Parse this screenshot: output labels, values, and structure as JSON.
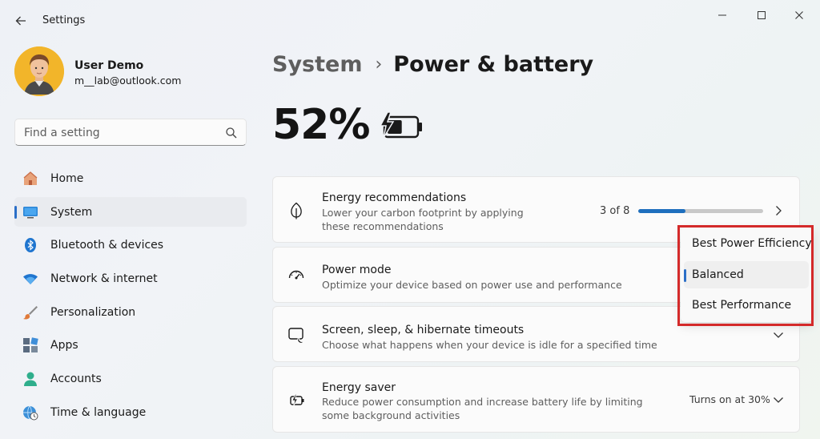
{
  "window": {
    "title": "Settings"
  },
  "user": {
    "name": "User Demo",
    "email": "m__lab@outlook.com"
  },
  "search": {
    "placeholder": "Find a setting"
  },
  "sidebar": {
    "items": [
      {
        "label": "Home",
        "icon": "home-icon",
        "selected": false
      },
      {
        "label": "System",
        "icon": "system-display-icon",
        "selected": true
      },
      {
        "label": "Bluetooth & devices",
        "icon": "bluetooth-icon",
        "selected": false
      },
      {
        "label": "Network & internet",
        "icon": "wifi-icon",
        "selected": false
      },
      {
        "label": "Personalization",
        "icon": "brush-icon",
        "selected": false
      },
      {
        "label": "Apps",
        "icon": "apps-icon",
        "selected": false
      },
      {
        "label": "Accounts",
        "icon": "accounts-icon",
        "selected": false
      },
      {
        "label": "Time & language",
        "icon": "globe-clock-icon",
        "selected": false
      }
    ]
  },
  "breadcrumb": {
    "parent": "System",
    "separator": "›",
    "current": "Power & battery"
  },
  "battery": {
    "percent": "52%",
    "charging": true,
    "level": 0.52
  },
  "cards": {
    "energy_recommendations": {
      "title": "Energy recommendations",
      "description": "Lower your carbon footprint by applying these recommendations",
      "progress_text": "3 of 8",
      "progress_fraction": 0.375
    },
    "power_mode": {
      "title": "Power mode",
      "description": "Optimize your device based on power use and performance"
    },
    "screen_sleep": {
      "title": "Screen, sleep, & hibernate timeouts",
      "description": "Choose what happens when your device is idle for a specified time"
    },
    "energy_saver": {
      "title": "Energy saver",
      "description": "Reduce power consumption and increase battery life by limiting some background activities",
      "value": "Turns on at 30%"
    }
  },
  "power_mode_dropdown": {
    "options": [
      "Best Power Efficiency",
      "Balanced",
      "Best Performance"
    ],
    "selected": "Balanced"
  },
  "colors": {
    "accent": "#2b6fc7",
    "progress": "#1e6fbe",
    "highlight_outline": "#d42a2a"
  }
}
